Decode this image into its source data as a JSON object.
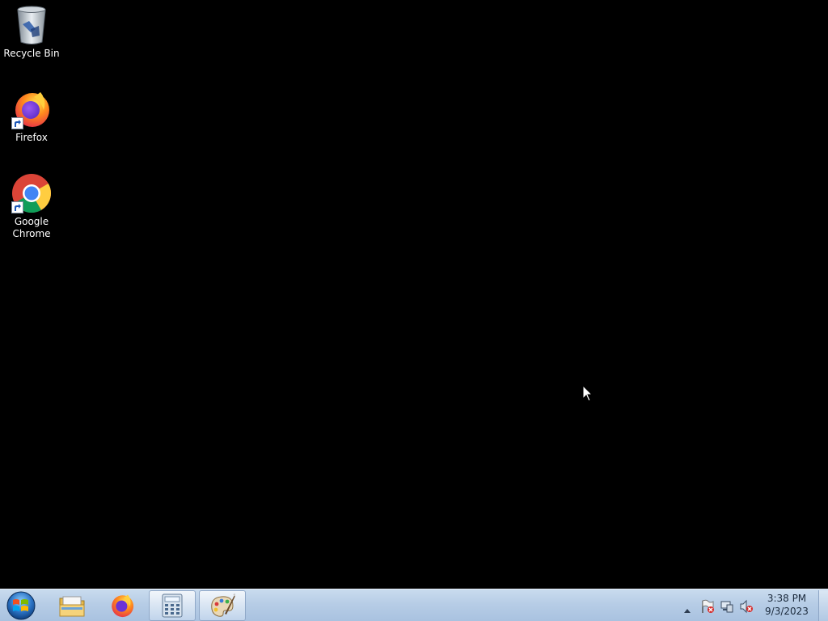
{
  "desktop": {
    "icons": [
      {
        "label": "Recycle Bin"
      },
      {
        "label": "Firefox"
      },
      {
        "label": "Google Chrome"
      }
    ]
  },
  "taskbar": {
    "start_button": "start-orb-icon",
    "pinned": [
      {
        "name": "File Explorer",
        "icon": "folder-icon"
      },
      {
        "name": "Firefox",
        "icon": "firefox-icon"
      },
      {
        "name": "Calculator",
        "icon": "calculator-icon"
      },
      {
        "name": "Paint",
        "icon": "paint-palette-icon"
      }
    ],
    "tray": {
      "icons": [
        "show-hidden-icons-arrow",
        "action-center-flag-icon",
        "network-icon",
        "volume-muted-icon"
      ],
      "clock": {
        "time": "3:38 PM",
        "date": "9/3/2023"
      }
    }
  }
}
